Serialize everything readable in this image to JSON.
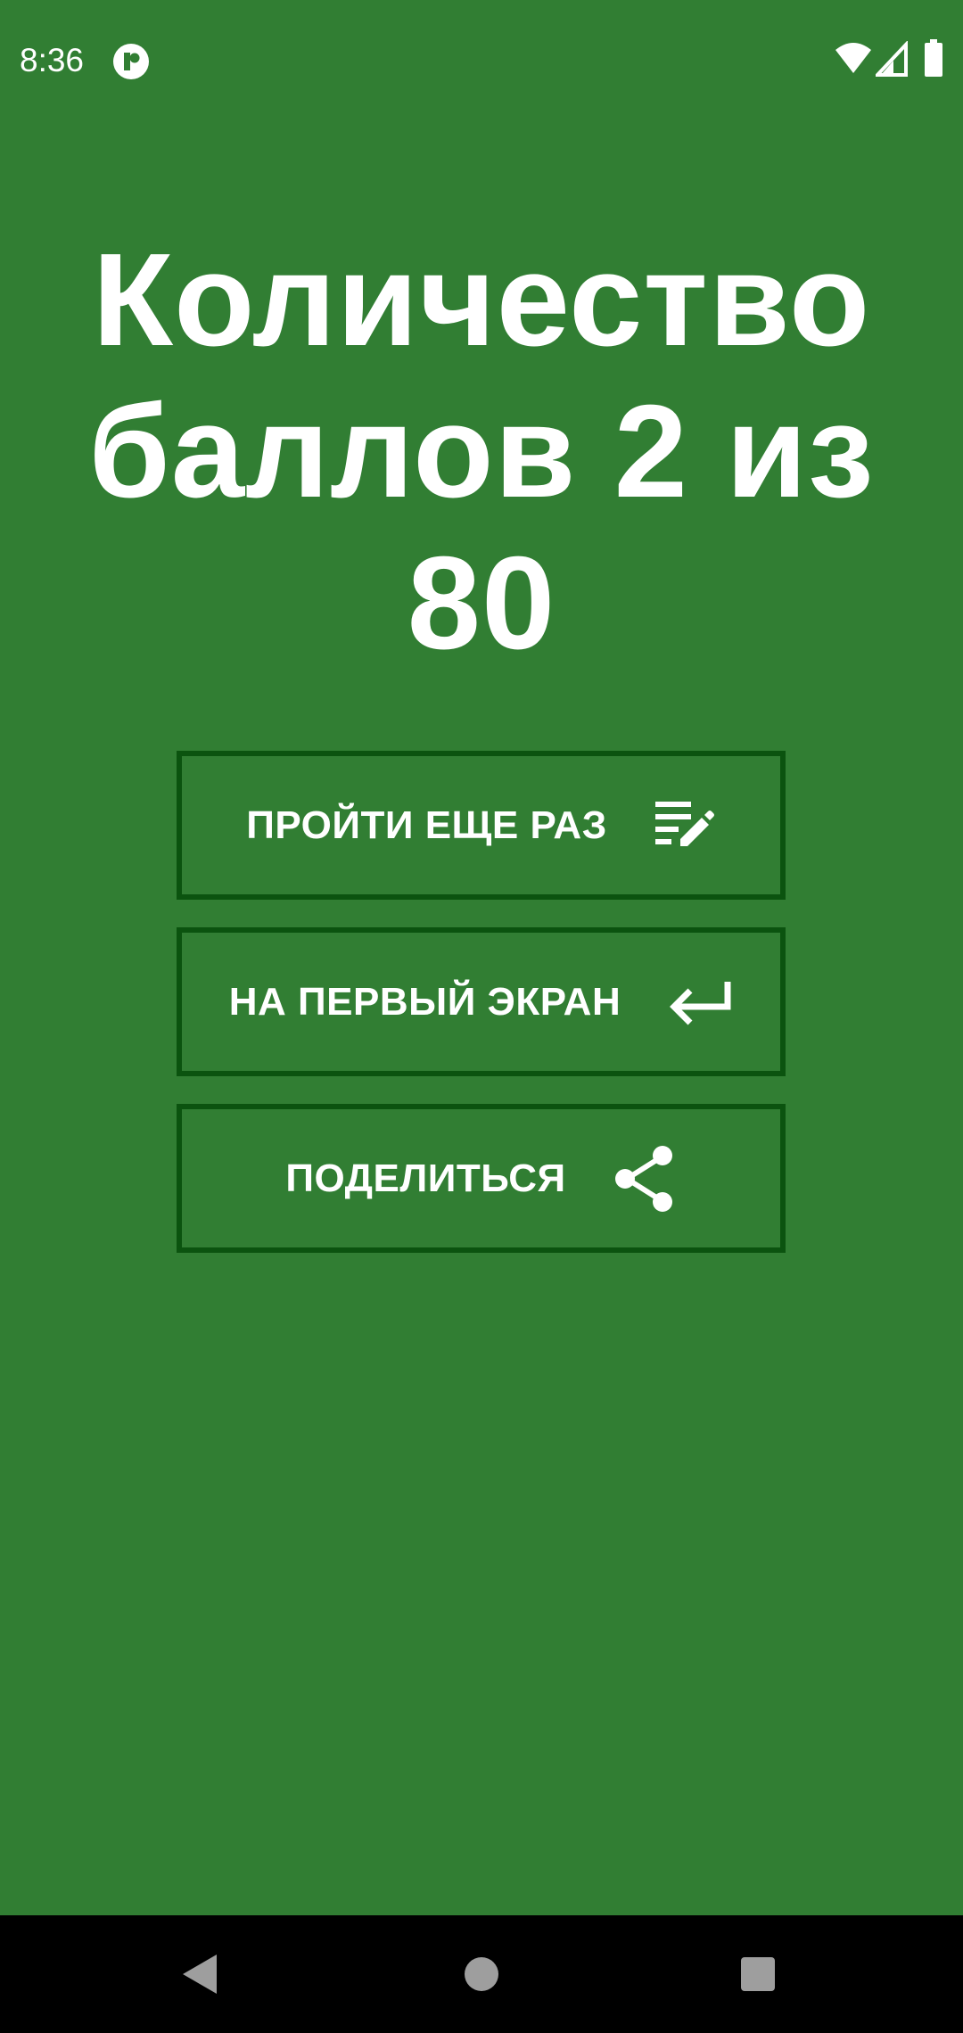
{
  "status_bar": {
    "time": "8:36",
    "app_icon": "app-notification-icon",
    "wifi_icon": "wifi-icon",
    "signal_icon": "cell-signal-icon",
    "battery_icon": "battery-icon"
  },
  "result": {
    "title": "Количество баллов 2 из 80"
  },
  "buttons": [
    {
      "label": "ПРОЙТИ ЕЩЕ РАЗ",
      "icon": "edit-list-icon"
    },
    {
      "label": "НА ПЕРВЫЙ ЭКРАН",
      "icon": "return-arrow-icon"
    },
    {
      "label": "ПОДЕЛИТЬСЯ",
      "icon": "share-icon"
    }
  ],
  "nav_bar": {
    "back_icon": "back-triangle-icon",
    "home_icon": "home-circle-icon",
    "recents_icon": "recents-square-icon"
  },
  "colors": {
    "background": "#317e33",
    "button_border": "#0b530f",
    "text": "#ffffff",
    "nav_bar": "#000000",
    "nav_icons": "#9e9e9e"
  }
}
